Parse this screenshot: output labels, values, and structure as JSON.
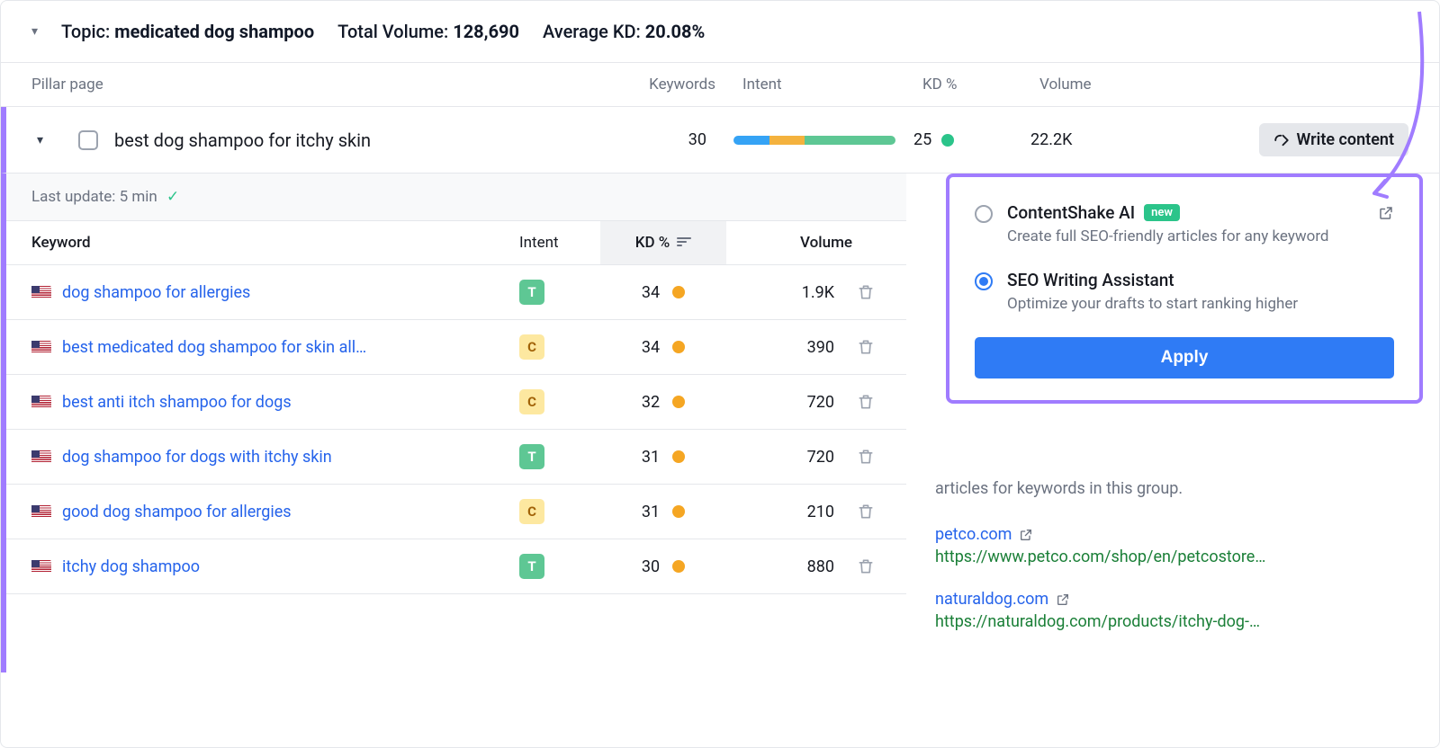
{
  "topic": {
    "label": "Topic:",
    "value": "medicated dog shampoo",
    "volume_label": "Total Volume:",
    "volume": "128,690",
    "kd_label": "Average KD:",
    "kd": "20.08%"
  },
  "table_header": {
    "pillar": "Pillar page",
    "keywords": "Keywords",
    "intent": "Intent",
    "kd": "KD %",
    "volume": "Volume"
  },
  "pillar": {
    "title": "best dog shampoo for itchy skin",
    "keywords": "30",
    "kd": "25",
    "volume": "22.2K",
    "write_label": "Write content"
  },
  "last_update": "Last update: 5 min",
  "columns": {
    "keyword": "Keyword",
    "intent": "Intent",
    "kd": "KD %",
    "volume": "Volume"
  },
  "rows": [
    {
      "kw": "dog shampoo for allergies",
      "intent": "T",
      "kd": "34",
      "vol": "1.9K"
    },
    {
      "kw": "best medicated dog shampoo for skin all…",
      "intent": "C",
      "kd": "34",
      "vol": "390"
    },
    {
      "kw": "best anti itch shampoo for dogs",
      "intent": "C",
      "kd": "32",
      "vol": "720"
    },
    {
      "kw": "dog shampoo for dogs with itchy skin",
      "intent": "T",
      "kd": "31",
      "vol": "720"
    },
    {
      "kw": "good dog shampoo for allergies",
      "intent": "C",
      "kd": "31",
      "vol": "210"
    },
    {
      "kw": "itchy dog shampoo",
      "intent": "T",
      "kd": "30",
      "vol": "880"
    }
  ],
  "popover": {
    "opt1_title": "ContentShake AI",
    "opt1_badge": "new",
    "opt1_desc": "Create full SEO-friendly articles for any keyword",
    "opt2_title": "SEO Writing Assistant",
    "opt2_desc": "Optimize your drafts to start ranking higher",
    "apply": "Apply"
  },
  "behind_text": "articles for keywords in this group.",
  "serp": [
    {
      "domain": "petco.com",
      "url": "https://www.petco.com/shop/en/petcostore…"
    },
    {
      "domain": "naturaldog.com",
      "url": "https://naturaldog.com/products/itchy-dog-…"
    }
  ]
}
